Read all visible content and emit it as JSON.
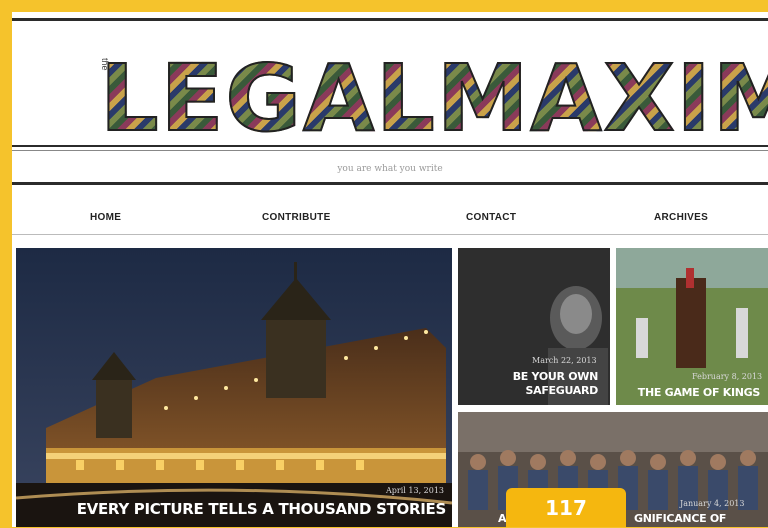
{
  "site": {
    "logo_text_1": "LEGAL",
    "logo_text_2": "MAXIM",
    "logo_small": "the",
    "tagline": "you are what you write"
  },
  "nav": {
    "items": [
      "HOME",
      "CONTRIBUTE",
      "CONTACT",
      "ARCHIVES"
    ]
  },
  "featured": {
    "date": "April 13, 2013",
    "title": "EVERY PICTURE TELLS A THOUSAND STORIES"
  },
  "tiles": [
    {
      "date": "March 22, 2013",
      "title_line1": "BE YOUR OWN",
      "title_line2": "SAFEGUARD"
    },
    {
      "date": "February 8, 2013",
      "title": "THE GAME OF KINGS"
    },
    {
      "date": "January 4, 2013",
      "title_left": "A",
      "title_right": "GNIFICANCE OF DIVERSITY"
    }
  ],
  "badge": {
    "count": "117"
  },
  "colors": {
    "frame": "#f5c32c",
    "badge": "#f5b70f",
    "rule": "#2b2b2b"
  }
}
